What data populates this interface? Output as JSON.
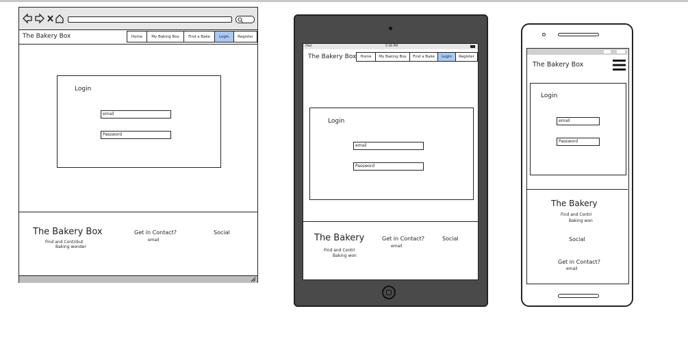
{
  "site": {
    "brand": "The Bakery Box",
    "brand_short": "The Bakery",
    "nav": [
      "Home",
      "My Baking Box",
      "Find a Bake",
      "Login",
      "Register"
    ],
    "active_nav": "Login"
  },
  "login": {
    "title": "Login",
    "email_placeholder": "email",
    "password_placeholder": "Password"
  },
  "footer": {
    "tagline_line1": "Find and Contribut",
    "tagline_line2": "Baking wonder",
    "tagline_short_line1": "Find and Contri",
    "tagline_short_line2": "Baking won",
    "contact_title": "Get in Contact?",
    "contact_email": "email",
    "social_title": "Social"
  },
  "tablet": {
    "status_left": "iPad",
    "status_time": "5:36 PM"
  },
  "colors": {
    "active_tab": "#a9c9f5",
    "device_frame": "#4a4a4a",
    "browser_chrome": "#e6e6e6"
  }
}
